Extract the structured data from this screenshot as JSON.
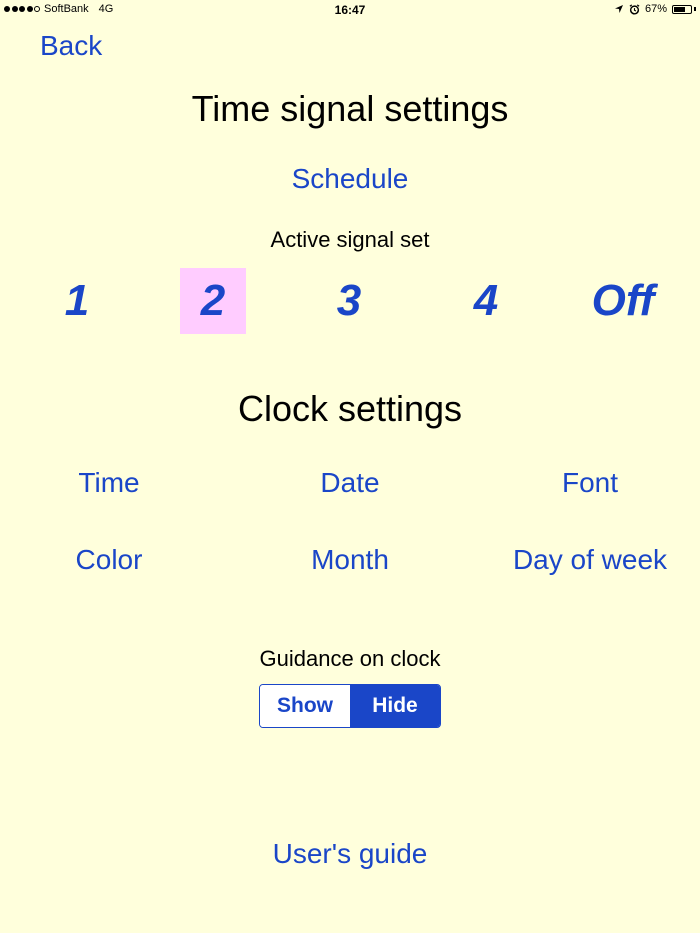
{
  "status_bar": {
    "carrier": "SoftBank",
    "network": "4G",
    "time": "16:47",
    "battery": "67%",
    "battery_level": 0.67,
    "icons": [
      "location-arrow-icon",
      "alarm-icon",
      "battery-icon"
    ]
  },
  "nav": {
    "back_label": "Back"
  },
  "time_signal": {
    "title": "Time signal settings",
    "schedule_label": "Schedule",
    "active_label": "Active signal set",
    "options": [
      "1",
      "2",
      "3",
      "4",
      "Off"
    ],
    "selected": "2"
  },
  "clock": {
    "title": "Clock settings",
    "items": [
      "Time",
      "Date",
      "Font",
      "Color",
      "Month",
      "Day of week"
    ]
  },
  "guidance": {
    "label": "Guidance on clock",
    "options": [
      "Show",
      "Hide"
    ],
    "selected": "Hide"
  },
  "footer": {
    "users_guide_label": "User's guide"
  },
  "colors": {
    "background": "#ffffdc",
    "accent": "#1a46c8",
    "highlight": "#ffccff"
  }
}
